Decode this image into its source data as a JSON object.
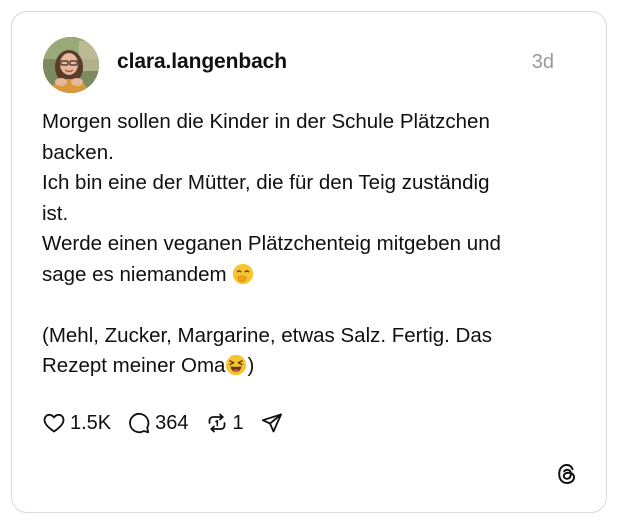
{
  "post": {
    "username": "clara.langenbach",
    "timestamp": "3d",
    "avatar_icon": "user-avatar",
    "text_lines": [
      "Morgen sollen die Kinder in der Schule Plätzchen",
      "backen.",
      "Ich bin eine der Mütter, die für den Teig zuständig",
      "ist.",
      "Werde einen veganen Plätzchenteig mitgeben und",
      "sage es niemandem",
      "",
      "(Mehl, Zucker, Margarine, etwas Salz. Fertig. Das",
      "Rezept meiner Oma",
      ")"
    ],
    "emojis": {
      "hand_over_mouth": "🤭",
      "laughing": "😆"
    }
  },
  "actions": {
    "like": {
      "icon": "heart-icon",
      "count": "1.5K"
    },
    "reply": {
      "icon": "comment-icon",
      "count": "364"
    },
    "repost": {
      "icon": "repost-icon",
      "count": "1"
    },
    "share": {
      "icon": "send-icon"
    }
  },
  "brand": {
    "icon": "threads-logo-icon"
  },
  "colors": {
    "text": "#101010",
    "muted": "#999999",
    "border": "#d9d9d9"
  }
}
